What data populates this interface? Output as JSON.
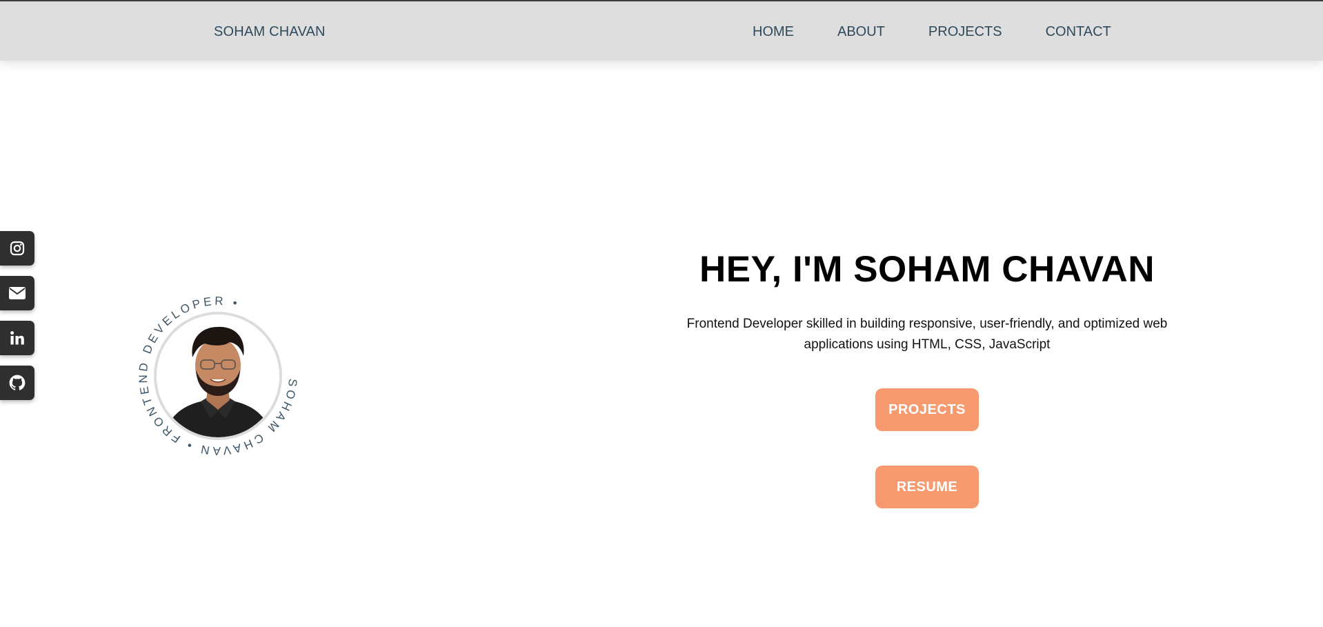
{
  "nav": {
    "brand": "SOHAM CHAVAN",
    "links": [
      "HOME",
      "ABOUT",
      "PROJECTS",
      "CONTACT"
    ]
  },
  "social": [
    {
      "icon": "instagram-icon"
    },
    {
      "icon": "envelope-icon"
    },
    {
      "icon": "linkedin-icon"
    },
    {
      "icon": "github-icon"
    }
  ],
  "avatar": {
    "ring_text": "SOHAM CHAVAN • FRONTEND DEVELOPER •"
  },
  "hero": {
    "title": "HEY, I'M SOHAM CHAVAN",
    "description": "Frontend Developer skilled in building responsive, user-friendly, and optimized web applications using HTML, CSS, JavaScript",
    "buttons": {
      "projects": "PROJECTS",
      "resume": "RESUME"
    }
  },
  "colors": {
    "navbar_bg": "#dedede",
    "nav_text": "#2e4a5a",
    "accent": "#f79a6f",
    "social_bg": "#2f2f2f"
  }
}
